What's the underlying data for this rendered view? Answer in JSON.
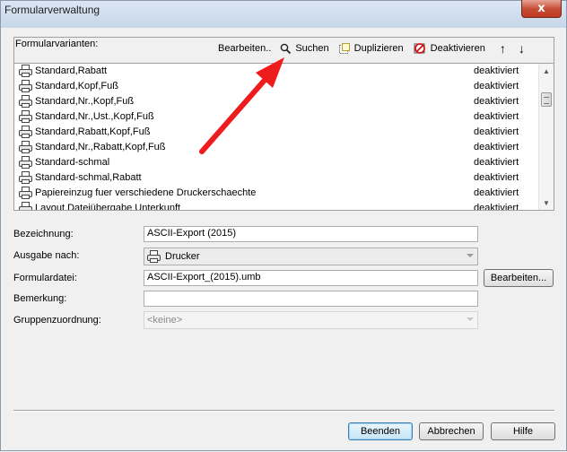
{
  "window": {
    "title": "Formularverwaltung",
    "close_glyph": "x"
  },
  "group": {
    "label": "Formularvarianten:",
    "toolbar": {
      "edit": "Bearbeiten..",
      "search": "Suchen",
      "duplicate": "Duplizieren",
      "deactivate": "Deaktivieren",
      "up_glyph": "↑",
      "down_glyph": "↓"
    }
  },
  "list": {
    "rows": [
      {
        "name": "Standard,Rabatt",
        "state": "deaktiviert"
      },
      {
        "name": "Standard,Kopf,Fuß",
        "state": "deaktiviert"
      },
      {
        "name": "Standard,Nr.,Kopf,Fuß",
        "state": "deaktiviert"
      },
      {
        "name": "Standard,Nr.,Ust.,Kopf,Fuß",
        "state": "deaktiviert"
      },
      {
        "name": "Standard,Rabatt,Kopf,Fuß",
        "state": "deaktiviert"
      },
      {
        "name": "Standard,Nr.,Rabatt,Kopf,Fuß",
        "state": "deaktiviert"
      },
      {
        "name": "Standard-schmal",
        "state": "deaktiviert"
      },
      {
        "name": "Standard-schmal,Rabatt",
        "state": "deaktiviert"
      },
      {
        "name": "Papiereinzug fuer verschiedene Druckerschaechte",
        "state": "deaktiviert"
      },
      {
        "name": "Layout Dateiübergabe Unterkunft",
        "state": "deaktiviert"
      }
    ]
  },
  "form": {
    "bezeichnung_label": "Bezeichnung:",
    "bezeichnung_value": "ASCII-Export (2015)",
    "ausgabe_label": "Ausgabe nach:",
    "ausgabe_value": "Drucker",
    "formulardatei_label": "Formulardatei:",
    "formulardatei_value": "ASCII-Export_(2015).umb",
    "formulardatei_button": "Bearbeiten...",
    "bemerkung_label": "Bemerkung:",
    "bemerkung_value": "",
    "gruppen_label": "Gruppenzuordnung:",
    "gruppen_value": "<keine>"
  },
  "footer": {
    "beenden": "Beenden",
    "abbrechen": "Abbrechen",
    "hilfe": "Hilfe"
  },
  "colors": {
    "annotation_arrow": "#ee1c1c",
    "default_button_border": "#3c7fb1"
  },
  "icons": {
    "row": "printer-icon",
    "search": "magnifier-icon",
    "duplicate": "duplicate-icon",
    "deactivate": "deactivate-icon"
  }
}
